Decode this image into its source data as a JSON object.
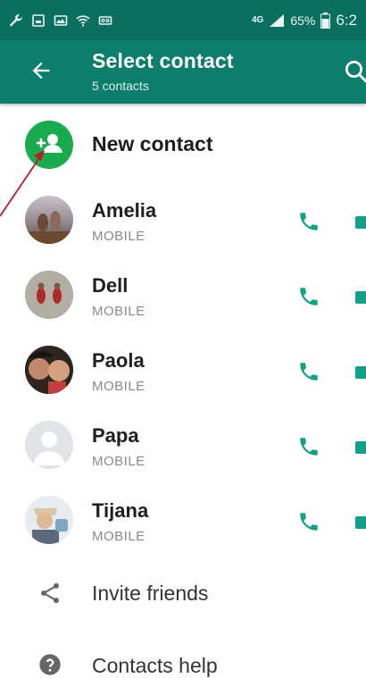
{
  "status_bar": {
    "network": "4G",
    "battery": "65%",
    "time": "6:2"
  },
  "app_bar": {
    "title": "Select contact",
    "subtitle": "5 contacts",
    "back_icon": "arrow-back-icon",
    "search_icon": "search-icon"
  },
  "new_contact": {
    "label": "New contact",
    "icon": "add-person-icon"
  },
  "contacts": [
    {
      "name": "Amelia",
      "type": "MOBILE"
    },
    {
      "name": "Dell",
      "type": "MOBILE"
    },
    {
      "name": "Paola",
      "type": "MOBILE"
    },
    {
      "name": "Papa",
      "type": "MOBILE"
    },
    {
      "name": "Tijana",
      "type": "MOBILE"
    }
  ],
  "actions": {
    "invite": {
      "label": "Invite friends",
      "icon": "share-icon"
    },
    "help": {
      "label": "Contacts help",
      "icon": "help-icon"
    }
  },
  "colors": {
    "status_bar": "#0a6f5e",
    "app_bar": "#0d7e6b",
    "accent": "#13a085",
    "new_contact": "#1aab4f",
    "annotation_arrow": "#c0182a"
  }
}
